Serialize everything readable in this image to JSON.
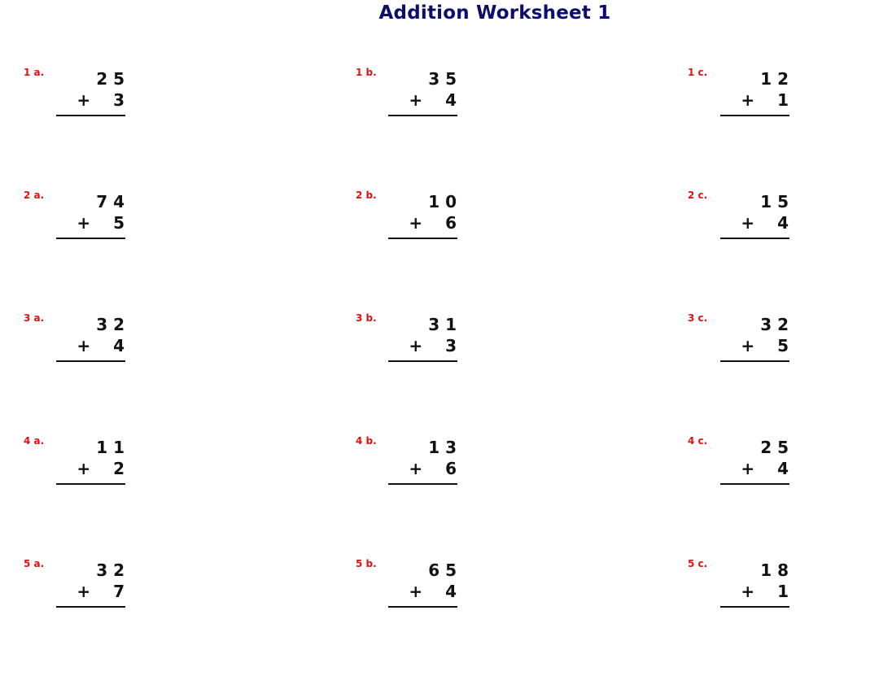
{
  "title": "Addition Worksheet 1",
  "operator": "+",
  "rows": [
    {
      "problems": [
        {
          "label": "1 a.",
          "top": "2 5",
          "bottom": "3"
        },
        {
          "label": "1 b.",
          "top": "3 5",
          "bottom": "4"
        },
        {
          "label": "1 c.",
          "top": "1 2",
          "bottom": "1"
        }
      ]
    },
    {
      "problems": [
        {
          "label": "2 a.",
          "top": "7 4",
          "bottom": "5"
        },
        {
          "label": "2 b.",
          "top": "1 0",
          "bottom": "6"
        },
        {
          "label": "2 c.",
          "top": "1 5",
          "bottom": "4"
        }
      ]
    },
    {
      "problems": [
        {
          "label": "3 a.",
          "top": "3 2",
          "bottom": "4"
        },
        {
          "label": "3 b.",
          "top": "3 1",
          "bottom": "3"
        },
        {
          "label": "3 c.",
          "top": "3 2",
          "bottom": "5"
        }
      ]
    },
    {
      "problems": [
        {
          "label": "4 a.",
          "top": "1 1",
          "bottom": "2"
        },
        {
          "label": "4 b.",
          "top": "1 3",
          "bottom": "6"
        },
        {
          "label": "4 c.",
          "top": "2 5",
          "bottom": "4"
        }
      ]
    },
    {
      "problems": [
        {
          "label": "5 a.",
          "top": "3 2",
          "bottom": "7"
        },
        {
          "label": "5 b.",
          "top": "6 5",
          "bottom": "4"
        },
        {
          "label": "5 c.",
          "top": "1 8",
          "bottom": "1"
        }
      ]
    }
  ],
  "colors": {
    "title": "#0d0d6e",
    "label": "#e01010",
    "digits": "#111111"
  }
}
